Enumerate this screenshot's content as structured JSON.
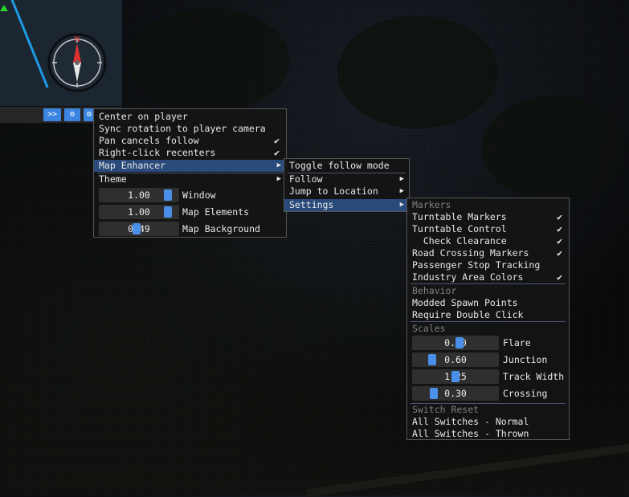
{
  "minimap": {
    "compass_north": "N",
    "buttons": [
      ">>",
      "⚙",
      "⚙"
    ]
  },
  "menu_main": {
    "items": [
      {
        "label": "Center on player"
      },
      {
        "label": "Sync rotation to player camera"
      },
      {
        "label": "Pan cancels follow",
        "checked": true
      },
      {
        "label": "Right-click recenters",
        "checked": true
      },
      {
        "label": "Map Enhancer",
        "submenu": true,
        "selected": true
      },
      {
        "label": "Theme",
        "submenu": true
      }
    ],
    "sliders": [
      {
        "value": "1.00",
        "fraction": 0.9,
        "label": "Window"
      },
      {
        "value": "1.00",
        "fraction": 0.9,
        "label": "Map Elements"
      },
      {
        "value": "0.49",
        "fraction": 0.47,
        "label": "Map Background"
      }
    ]
  },
  "menu_enhancer": {
    "items": [
      {
        "label": "Toggle follow mode"
      },
      {
        "label": "Follow",
        "submenu": true
      },
      {
        "label": "Jump to Location",
        "submenu": true
      },
      {
        "label": "Settings",
        "submenu": true,
        "selected": true
      }
    ]
  },
  "menu_settings": {
    "markers_header": "Markers",
    "markers": [
      {
        "label": "Turntable Markers",
        "checked": true
      },
      {
        "label": "Turntable Control",
        "checked": true
      },
      {
        "label": "  Check Clearance",
        "checked": true
      },
      {
        "label": "Road Crossing Markers",
        "checked": true
      },
      {
        "label": "Passenger Stop Tracking",
        "checked": false
      },
      {
        "label": "Industry Area Colors",
        "checked": true
      }
    ],
    "behavior_header": "Behavior",
    "behavior": [
      {
        "label": "Modded Spawn Points"
      },
      {
        "label": "Require Double Click"
      }
    ],
    "scales_header": "Scales",
    "scales": [
      {
        "value": "0.60",
        "fraction": 0.55,
        "label": "Flare"
      },
      {
        "value": "0.60",
        "fraction": 0.2,
        "label": "Junction"
      },
      {
        "value": "1.25",
        "fraction": 0.5,
        "label": "Track Width"
      },
      {
        "value": "0.30",
        "fraction": 0.22,
        "label": "Crossing"
      }
    ],
    "switch_header": "Switch Reset",
    "switch": [
      {
        "label": "All Switches - Normal"
      },
      {
        "label": "All Switches - Thrown"
      }
    ]
  }
}
